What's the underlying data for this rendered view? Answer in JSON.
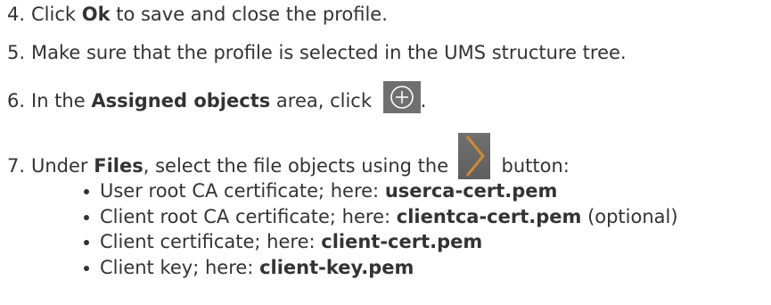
{
  "steps": [
    {
      "num": "4.",
      "pre": "Click ",
      "bold": "Ok",
      "post": " to save and close the profile."
    },
    {
      "num": "5.",
      "text": "Make sure that the profile is selected in the UMS structure tree."
    },
    {
      "num": "6.",
      "pre": "In the ",
      "bold": "Assigned objects",
      "mid": " area, click ",
      "post": ".",
      "icon": "add-circle-icon"
    },
    {
      "num": "7.",
      "pre": "Under ",
      "bold": "Files",
      "mid": ", select the file objects using the ",
      "post": " button:",
      "icon": "chevron-right-icon"
    }
  ],
  "files": [
    {
      "pre": "User root CA certificate; here: ",
      "bold": "userca-cert.pem",
      "post": ""
    },
    {
      "pre": "Client root CA certificate; here: ",
      "bold": "clientca-cert.pem",
      "post": " (optional)"
    },
    {
      "pre": "Client certificate; here: ",
      "bold": "client-cert.pem",
      "post": ""
    },
    {
      "pre": "Client key; here: ",
      "bold": "client-key.pem",
      "post": ""
    }
  ],
  "colors": {
    "text": "#333333",
    "icon_bg": "#6f6f6f",
    "chevron": "#d08a2e"
  }
}
